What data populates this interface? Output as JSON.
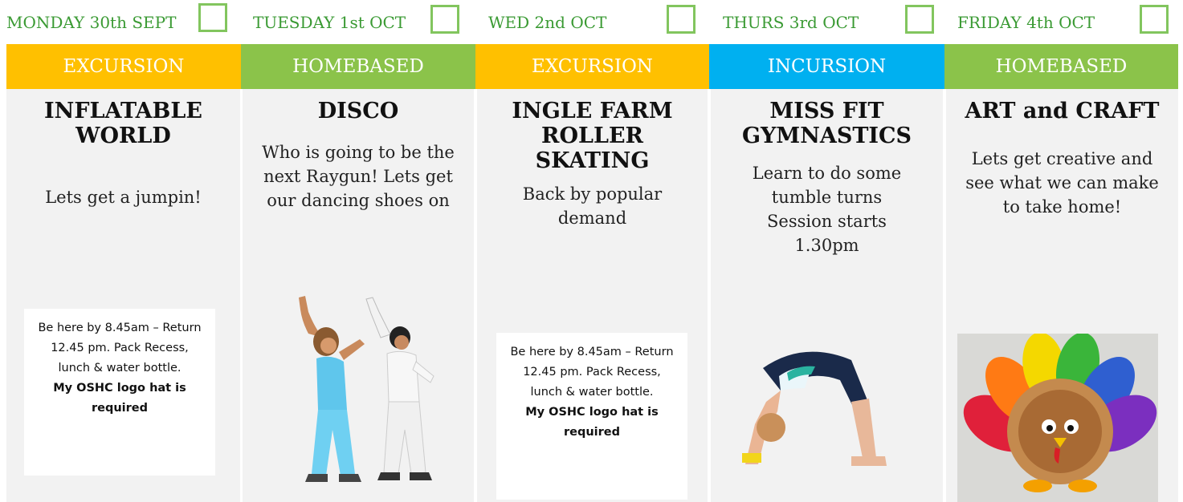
{
  "days": [
    {
      "day": "MONDAY 30th SEPT",
      "type": "EXCURSION",
      "title": "INFLATABLE WORLD",
      "description": "Lets get a jumpin!",
      "note": {
        "text": "Be here by 8.45am – Return 12.45 pm. Pack Recess, lunch & water bottle.",
        "bold": "My OSHC logo hat is required"
      }
    },
    {
      "day": "TUESDAY 1st OCT",
      "type": "HOMEBASED",
      "title": "DISCO",
      "description": "Who is going to be the next Raygun! Lets get our dancing shoes on"
    },
    {
      "day": "WED 2nd OCT",
      "type": "EXCURSION",
      "title": "INGLE FARM ROLLER SKATING",
      "description": "Back by popular demand",
      "note": {
        "text": "Be here by 8.45am – Return 12.45 pm. Pack Recess, lunch & water bottle.",
        "bold": "My OSHC logo hat is required"
      }
    },
    {
      "day": "THURS 3rd OCT",
      "type": "INCURSION",
      "title": "MISS FIT GYMNASTICS",
      "description": "Learn to do some tumble turns Session starts 1.30pm"
    },
    {
      "day": "FRIDAY 4th OCT",
      "type": "HOMEBASED",
      "title": "ART and CRAFT",
      "description": "Lets get creative and see what we can make to take home!"
    }
  ],
  "colors": {
    "excursion": "#ffc000",
    "homebased": "#8bc34a",
    "incursion": "#00b0f0",
    "day_text": "#3a9a33",
    "checkbox": "#82c55e"
  },
  "illustrations": [
    "disco-dancers-image",
    "gymnast-backbend-image",
    "paper-plate-turkey-image"
  ]
}
